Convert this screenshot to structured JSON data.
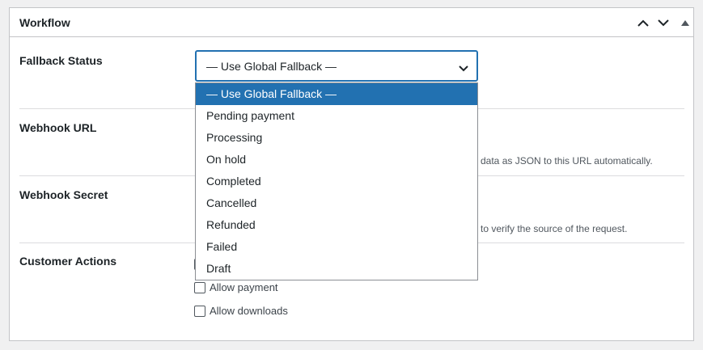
{
  "panel": {
    "title": "Workflow",
    "controls": {
      "move_up_icon": "chevron-up-icon",
      "move_down_icon": "chevron-down-icon",
      "toggle_icon": "triangle-up-icon"
    }
  },
  "fields": {
    "fallback_status": {
      "label": "Fallback Status",
      "selected": "— Use Global Fallback —",
      "options": [
        "— Use Global Fallback —",
        "Pending payment",
        "Processing",
        "On hold",
        "Completed",
        "Cancelled",
        "Refunded",
        "Failed",
        "Draft"
      ]
    },
    "webhook_url": {
      "label": "Webhook URL",
      "description_visible": "data as JSON to this URL automatically."
    },
    "webhook_secret": {
      "label": "Webhook Secret",
      "description_visible": "to verify the source of the request."
    },
    "customer_actions": {
      "label": "Customer Actions",
      "options": [
        {
          "label": "Allow payment",
          "checked": false
        },
        {
          "label": "Allow downloads",
          "checked": false
        }
      ]
    }
  },
  "colors": {
    "accent": "#2271b1",
    "border": "#c3c4c7",
    "background": "#f0f0f1"
  }
}
